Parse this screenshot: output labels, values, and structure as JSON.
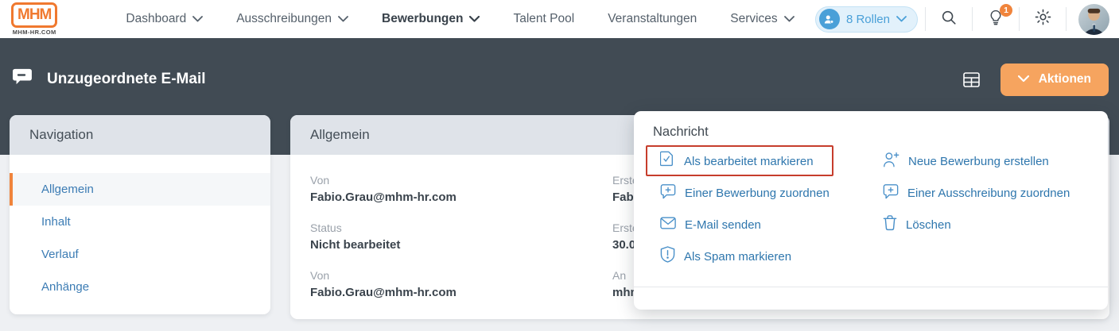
{
  "brand": {
    "logo_text": "MHM",
    "logo_subtext": "MHM-HR.COM"
  },
  "topnav": {
    "items": [
      {
        "label": "Dashboard",
        "has_chevron": true,
        "active": false
      },
      {
        "label": "Ausschreibungen",
        "has_chevron": true,
        "active": false
      },
      {
        "label": "Bewerbungen",
        "has_chevron": true,
        "active": true
      },
      {
        "label": "Talent Pool",
        "has_chevron": false,
        "active": false
      },
      {
        "label": "Veranstaltungen",
        "has_chevron": false,
        "active": false
      },
      {
        "label": "Services",
        "has_chevron": true,
        "active": false
      }
    ],
    "roles_pill": {
      "label": "8 Rollen"
    },
    "notifications_badge": "1"
  },
  "header": {
    "title": "Unzugeordnete E-Mail",
    "actions_button": "Aktionen"
  },
  "sidebar": {
    "title": "Navigation",
    "items": [
      {
        "label": "Allgemein",
        "active": true
      },
      {
        "label": "Inhalt",
        "active": false
      },
      {
        "label": "Verlauf",
        "active": false
      },
      {
        "label": "Anhänge",
        "active": false
      }
    ]
  },
  "main": {
    "title": "Allgemein",
    "left_fields": [
      {
        "label": "Von",
        "value": "Fabio.Grau@mhm-hr.com"
      },
      {
        "label": "Status",
        "value": "Nicht bearbeitet"
      },
      {
        "label": "Von",
        "value": "Fabio.Grau@mhm-hr.com"
      }
    ],
    "right_fields_partially_hidden": [
      {
        "label": "Erste",
        "value": "Fabi"
      },
      {
        "label": "Erste",
        "value": "30.0"
      },
      {
        "label": "An",
        "value": "mhm"
      }
    ]
  },
  "menu": {
    "title": "Nachricht",
    "left_items": [
      {
        "label": "Als bearbeitet markieren",
        "icon": "document-check-icon",
        "highlighted": true
      },
      {
        "label": "Einer Bewerbung zuordnen",
        "icon": "bubble-plus-icon",
        "highlighted": false
      },
      {
        "label": "E-Mail senden",
        "icon": "envelope-icon",
        "highlighted": false
      },
      {
        "label": "Als Spam markieren",
        "icon": "shield-alert-icon",
        "highlighted": false
      }
    ],
    "right_items": [
      {
        "label": "Neue Bewerbung erstellen",
        "icon": "person-plus-icon"
      },
      {
        "label": "Einer Ausschreibung zuordnen",
        "icon": "bubble-plus-icon"
      },
      {
        "label": "Löschen",
        "icon": "trash-icon"
      }
    ]
  },
  "colors": {
    "accent_orange": "#f0843c",
    "button_orange": "#f6a45f",
    "banner_dark": "#414b54",
    "page_background": "#eef0f3",
    "card_header_strip": "#dfe3e9",
    "link_blue": "#2e76ad",
    "icon_blue": "#4a90c9",
    "pill_blue": "#4aa0d8",
    "label_gray": "#9aa1aa",
    "value_dark": "#3a434c",
    "annotation_red": "#c63d2c"
  }
}
